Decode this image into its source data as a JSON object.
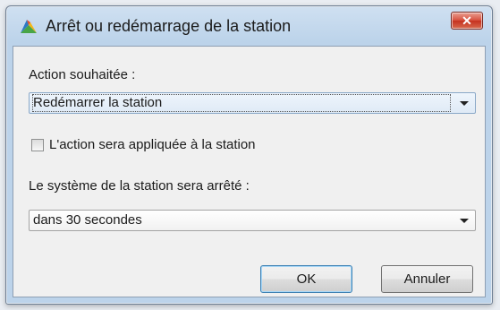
{
  "window": {
    "title": "Arrêt ou redémarrage de la station",
    "close_label": "✕",
    "app_icon": "avg-logo-icon"
  },
  "action": {
    "label": "Action souhaitée :",
    "selected": "Redémarrer la station"
  },
  "apply_checkbox": {
    "label": "L'action sera appliquée à la station",
    "checked": false
  },
  "delay": {
    "label": "Le système de la station sera arrêté :",
    "selected": "dans 30 secondes"
  },
  "buttons": {
    "ok": "OK",
    "cancel": "Annuler"
  },
  "colors": {
    "titlebar": "#bcd3ea",
    "close_button": "#c5321f",
    "dialog_background": "#f0f0f0"
  }
}
